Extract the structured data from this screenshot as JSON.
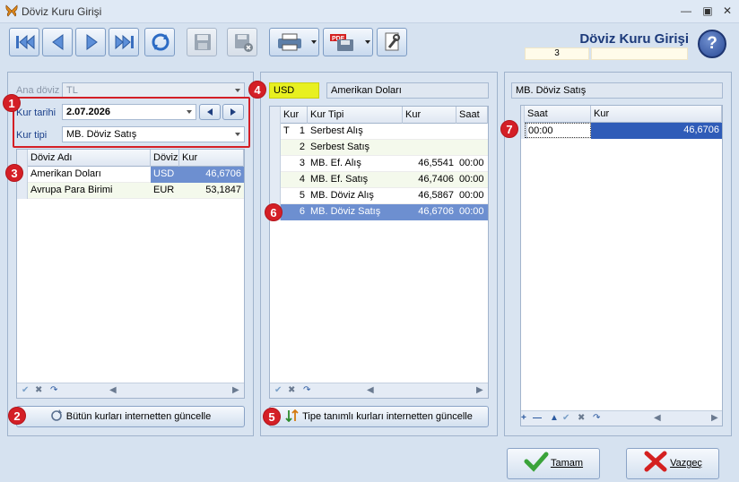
{
  "window": {
    "title": "Döviz Kuru Girişi"
  },
  "toolbar": {
    "buttons": [
      "first",
      "previous",
      "next",
      "last",
      "refresh",
      "save-disabled",
      "delete-disabled",
      "print",
      "pdf-export",
      "tools"
    ],
    "form_title": "Döviz Kuru Girişi",
    "record_no": "3",
    "help_label": "?"
  },
  "markers": [
    "1",
    "2",
    "3",
    "4",
    "5",
    "6",
    "7"
  ],
  "left_panel": {
    "ana_doviz_label": "Ana döviz",
    "ana_doviz_value": "TL",
    "kur_tarihi_label": "Kur tarihi",
    "kur_tarihi_value": "2.07.2026",
    "kur_tipi_label": "Kur tipi",
    "kur_tipi_value": "MB. Döviz Satış",
    "grid": {
      "columns": [
        "Döviz Adı",
        "Döviz",
        "Kur"
      ],
      "rows": [
        {
          "name": "Amerikan Doları",
          "code": "USD",
          "rate": "46,6706",
          "selected": true
        },
        {
          "name": "Avrupa Para Birimi",
          "code": "EUR",
          "rate": "53,1847",
          "selected": false
        }
      ]
    },
    "update_all_button": "Bütün kurları internetten güncelle"
  },
  "middle_panel": {
    "currency_code": "USD",
    "currency_name": "Amerikan Doları",
    "grid": {
      "columns": [
        "Kur T",
        "Kur Tipi",
        "Kur",
        "Saat"
      ],
      "rows": [
        {
          "no": "1",
          "type": "Serbest Alış",
          "rate": "",
          "time": ""
        },
        {
          "no": "2",
          "type": "Serbest Satış",
          "rate": "",
          "time": ""
        },
        {
          "no": "3",
          "type": "MB. Ef. Alış",
          "rate": "46,5541",
          "time": "00:00"
        },
        {
          "no": "4",
          "type": "MB. Ef. Satış",
          "rate": "46,7406",
          "time": "00:00"
        },
        {
          "no": "5",
          "type": "MB. Döviz Alış",
          "rate": "46,5867",
          "time": "00:00"
        },
        {
          "no": "6",
          "type": "MB. Döviz Satış",
          "rate": "46,6706",
          "time": "00:00"
        }
      ]
    },
    "update_defined_button": "Tipe tanımlı kurları internetten güncelle"
  },
  "right_panel": {
    "caption": "MB. Döviz Satış",
    "grid": {
      "columns": [
        "Saat",
        "Kur"
      ],
      "rows": [
        {
          "time": "00:00",
          "rate": "46,6706"
        }
      ]
    }
  },
  "footer": {
    "ok_label": "Tamam",
    "cancel_label": "Vazgeç"
  },
  "colors": {
    "marker": "#d41f26",
    "selection": "#6d8fd0",
    "usd_highlight": "#e8f020",
    "title_blue": "#1c3a7a"
  }
}
